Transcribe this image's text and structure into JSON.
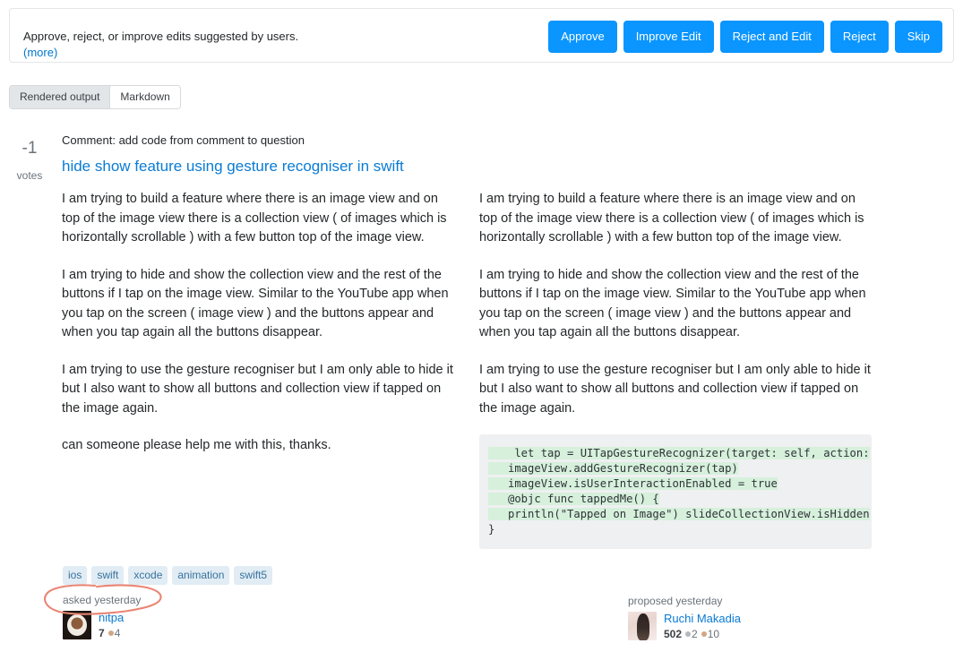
{
  "review": {
    "description": "Approve, reject, or improve edits suggested by users.",
    "more_label": "(more)",
    "buttons": [
      {
        "label": "Approve"
      },
      {
        "label": "Improve Edit"
      },
      {
        "label": "Reject and Edit"
      },
      {
        "label": "Reject"
      },
      {
        "label": "Skip"
      }
    ],
    "accent_color": "#0a95ff"
  },
  "tabs": [
    {
      "label": "Rendered output",
      "active": true
    },
    {
      "label": "Markdown",
      "active": false
    }
  ],
  "post": {
    "vote_count": "-1",
    "vote_label": "votes",
    "edit_comment": "Comment: add code from comment to question",
    "title": "hide show feature using gesture recogniser in swift"
  },
  "body": {
    "paragraphs": [
      "I am trying to build a feature where there is an image view and on top of the image view there is a collection view ( of images which is horizontally scrollable ) with a few button top of the image view.",
      "I am trying to hide and show the collection view and the rest of the buttons if I tap on the image view. Similar to the YouTube app when you tap on the screen ( image view ) and the buttons appear and when you tap again all the buttons disappear.",
      "I am trying to use the gesture recogniser but I am only able to hide it but I also want to show all buttons and collection view if tapped on the image again.",
      "can someone please help me with this, thanks."
    ]
  },
  "code": {
    "lines": [
      {
        "text": "    let tap = UITapGestureRecognizer(target: self, action:",
        "inserted": true
      },
      {
        "text": "   imageView.addGestureRecognizer(tap)",
        "inserted": true
      },
      {
        "text": "   imageView.isUserInteractionEnabled = true",
        "inserted": true
      },
      {
        "text": "   @objc func tappedMe() {",
        "inserted": true
      },
      {
        "text": "   println(\"Tapped on Image\") slideCollectionView.isHidden",
        "inserted": true
      },
      {
        "text": "}",
        "inserted": false
      }
    ],
    "background": "#eff0f1",
    "inserted_background": "#d6f0dc"
  },
  "tags": [
    {
      "label": "ios"
    },
    {
      "label": "swift"
    },
    {
      "label": "xcode"
    },
    {
      "label": "animation"
    },
    {
      "label": "swift5"
    }
  ],
  "users": {
    "asker": {
      "action": "asked yesterday",
      "name": "nitpa",
      "reputation": "7",
      "bronze": "4"
    },
    "proposer": {
      "action": "proposed yesterday",
      "name": "Ruchi Makadia",
      "reputation": "502",
      "silver": "2",
      "bronze": "10"
    }
  },
  "annotation": {
    "shape": "hand-drawn-oval",
    "color": "#ea8573",
    "target": "asked yesterday"
  }
}
